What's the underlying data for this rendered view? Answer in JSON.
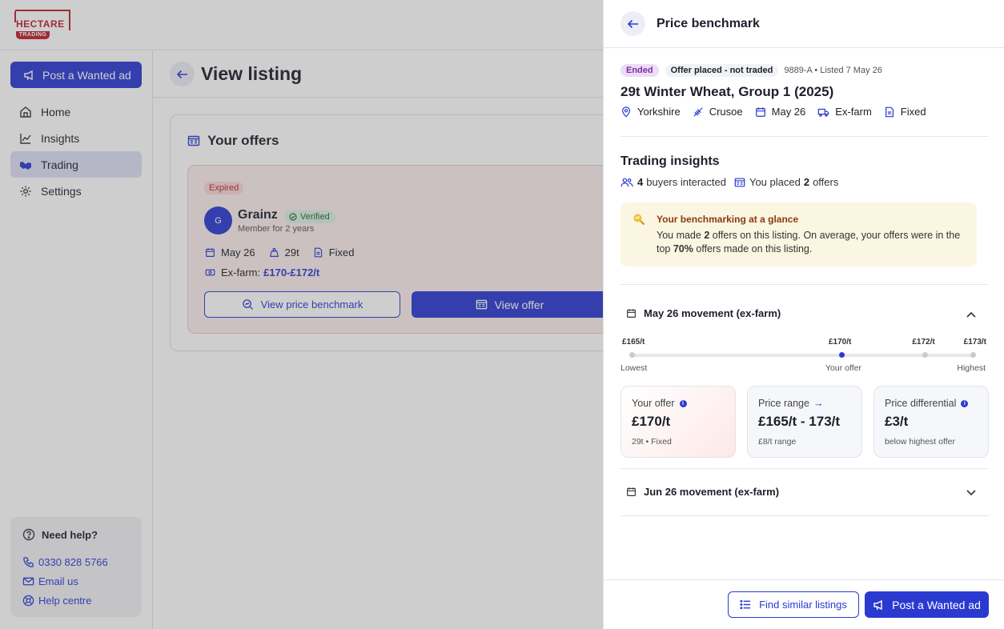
{
  "brand": {
    "name": "HECTARE",
    "sub": "TRADING"
  },
  "sidebar": {
    "post_label": "Post a Wanted ad",
    "items": [
      {
        "label": "Home",
        "icon": "home-icon"
      },
      {
        "label": "Insights",
        "icon": "chart-icon"
      },
      {
        "label": "Trading",
        "icon": "handshake-icon"
      },
      {
        "label": "Settings",
        "icon": "gear-icon"
      }
    ],
    "help": {
      "title": "Need help?",
      "phone": "0330 828 5766",
      "email": "Email us",
      "centre": "Help centre"
    }
  },
  "main": {
    "title": "View listing",
    "offers_title": "Your offers",
    "offer": {
      "status": "Expired",
      "avatar": "G",
      "seller": "Grainz",
      "verified": "Verified",
      "member": "Member for 2 years",
      "month": "May 26",
      "tonnage": "29t",
      "pricing": "Fixed",
      "price_label": "Ex-farm:",
      "price_value": "£170-£172/t",
      "benchmark_button": "View price benchmark",
      "view_offer_button": "View offer"
    }
  },
  "panel": {
    "title": "Price benchmark",
    "status": "Ended",
    "offer_status": "Offer placed - not traded",
    "listing_ref": "9889-A • Listed 7 May 26",
    "listing_title": "29t Winter Wheat, Group 1 (2025)",
    "attrs": {
      "region": "Yorkshire",
      "variety": "Crusoe",
      "month": "May 26",
      "delivery": "Ex-farm",
      "pricing": "Fixed"
    },
    "insights": {
      "title": "Trading insights",
      "buyers_count": "4",
      "buyers_text": "buyers interacted",
      "placed_pre": "You placed",
      "placed_count": "2",
      "placed_post": "offers"
    },
    "glance": {
      "title": "Your benchmarking at a glance",
      "t1": "You made ",
      "n1": "2",
      "t2": " offers on this listing. On average, your offers were in the top ",
      "n2": "70%",
      "t3": " offers made on this listing."
    },
    "may": {
      "title": "May 26 movement (ex-farm)",
      "points": [
        {
          "label": "£165/t",
          "fraction": 0.0,
          "yours": false
        },
        {
          "label": "£170/t",
          "fraction": 0.615,
          "yours": true
        },
        {
          "label": "£172/t",
          "fraction": 0.86,
          "yours": false
        },
        {
          "label": "£173/t",
          "fraction": 1.0,
          "yours": false
        }
      ],
      "lowest": "Lowest",
      "your_offer": "Your offer",
      "highest": "Highest",
      "stats": [
        {
          "label": "Your offer",
          "value": "£170/t",
          "sub": "29t • Fixed"
        },
        {
          "label": "Price range",
          "value": "£165/t - 173/t",
          "sub": "£8/t range"
        },
        {
          "label": "Price differential",
          "value": "£3/t",
          "sub": "below highest offer"
        }
      ]
    },
    "jun": {
      "title": "Jun 26 movement (ex-farm)"
    },
    "footer": {
      "similar": "Find similar listings",
      "post": "Post a Wanted ad"
    }
  },
  "colors": {
    "accent": "#2a3ad1",
    "brand": "#c0202a",
    "glance_bg": "#fbf6e2"
  }
}
